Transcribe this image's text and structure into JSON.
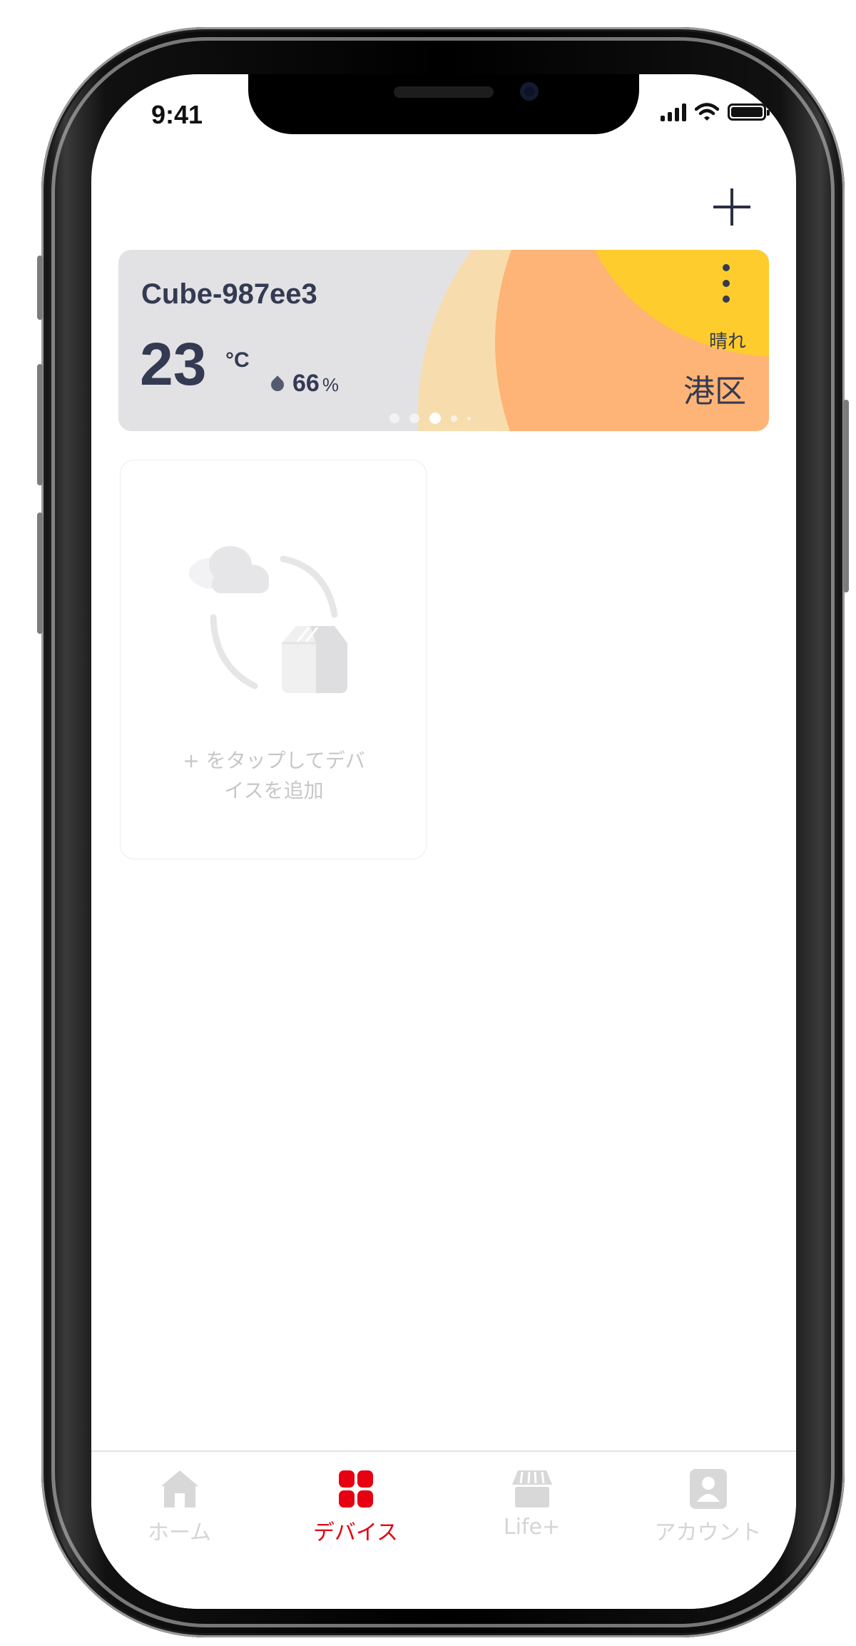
{
  "status_bar": {
    "time": "9:41",
    "icons": [
      "signal-icon",
      "wifi-icon",
      "battery-icon"
    ]
  },
  "header": {
    "add_icon": "plus-icon"
  },
  "weather_card": {
    "device_name": "Cube-987ee3",
    "temperature": "23",
    "temperature_unit": "°C",
    "humidity": "66",
    "humidity_unit": "%",
    "condition": "晴れ",
    "location": "港区",
    "menu_icon": "more-vertical-icon",
    "pager": {
      "pages": 5,
      "active_index": 2
    },
    "colors": {
      "card_bg": "#e2e2e4",
      "arc_light": "#f7ddad",
      "arc_orange": "#fdb476",
      "sun": "#ffcc2d",
      "text": "#343a52"
    }
  },
  "empty_device": {
    "hint": "+ をタップしてデバ\nイスを追加",
    "illustration": "cloud-device-sync-icon"
  },
  "tab_bar": {
    "active_color": "#e60012",
    "inactive_color": "#d5d5d5",
    "tabs": [
      {
        "label": "ホーム",
        "icon": "home-icon",
        "active": false
      },
      {
        "label": "デバイス",
        "icon": "devices-grid-icon",
        "active": true
      },
      {
        "label": "Life+",
        "icon": "store-icon",
        "active": false
      },
      {
        "label": "アカウント",
        "icon": "account-icon",
        "active": false
      }
    ]
  }
}
